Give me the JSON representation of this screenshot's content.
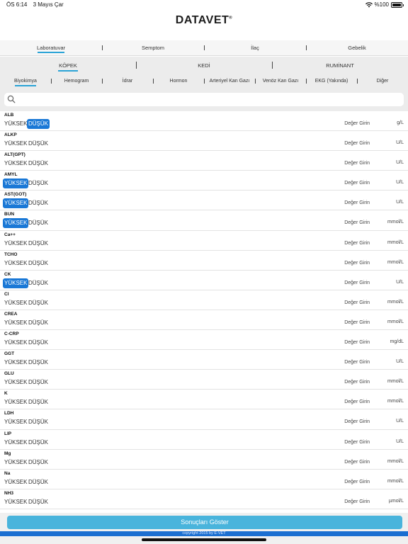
{
  "status_bar": {
    "time": "ÖS 6:14",
    "date": "3 Mayıs Çar",
    "battery": "%100",
    "battery_level": 1.0
  },
  "header": {
    "logo": "DATAVET",
    "logo_mark": "®",
    "close_icon": "close-icon"
  },
  "main_tabs": [
    {
      "label": "Laboratuvar",
      "active": true
    },
    {
      "label": "Semptom",
      "active": false
    },
    {
      "label": "İlaç",
      "active": false
    },
    {
      "label": "Gebelik",
      "active": false
    }
  ],
  "species_tabs": [
    {
      "label": "KÖPEK",
      "active": true
    },
    {
      "label": "KEDİ",
      "active": false
    },
    {
      "label": "RUMİNANT",
      "active": false
    }
  ],
  "category_tabs": [
    {
      "label": "Biyokimya",
      "active": true
    },
    {
      "label": "Hemogram",
      "active": false
    },
    {
      "label": "İdrar",
      "active": false
    },
    {
      "label": "Hormon",
      "active": false
    },
    {
      "label": "Arteriyel Kan Gazı",
      "active": false
    },
    {
      "label": "Venöz Kan Gazı",
      "active": false
    },
    {
      "label": "EKG (Yakında)",
      "active": false
    },
    {
      "label": "Diğer",
      "active": false
    }
  ],
  "search": {
    "placeholder": "",
    "icon": "search-icon"
  },
  "labels": {
    "high": "YÜKSEK",
    "low": "DÜŞÜK",
    "enter": "Değer Girin"
  },
  "tests": [
    {
      "name": "ALB",
      "unit": "g/L",
      "selected": "low"
    },
    {
      "name": "ALKP",
      "unit": "U/L",
      "selected": ""
    },
    {
      "name": "ALT(GPT)",
      "unit": "U/L",
      "selected": ""
    },
    {
      "name": "AMYL",
      "unit": "U/L",
      "selected": "high"
    },
    {
      "name": "AST(GOT)",
      "unit": "U/L",
      "selected": "high"
    },
    {
      "name": "BUN",
      "unit": "mmol/L",
      "selected": "high"
    },
    {
      "name": "Ca++",
      "unit": "mmol/L",
      "selected": ""
    },
    {
      "name": "TCHO",
      "unit": "mmol/L",
      "selected": ""
    },
    {
      "name": "CK",
      "unit": "U/L",
      "selected": "high"
    },
    {
      "name": "Cl",
      "unit": "mmol/L",
      "selected": ""
    },
    {
      "name": "CREA",
      "unit": "mmol/L",
      "selected": ""
    },
    {
      "name": "C-CRP",
      "unit": "mg/dL",
      "selected": ""
    },
    {
      "name": "GGT",
      "unit": "U/L",
      "selected": ""
    },
    {
      "name": "GLU",
      "unit": "mmol/L",
      "selected": ""
    },
    {
      "name": "K",
      "unit": "mmol/L",
      "selected": ""
    },
    {
      "name": "LDH",
      "unit": "U/L",
      "selected": ""
    },
    {
      "name": "LIP",
      "unit": "U/L",
      "selected": ""
    },
    {
      "name": "Mg",
      "unit": "mmol/L",
      "selected": ""
    },
    {
      "name": "Na",
      "unit": "mmol/L",
      "selected": ""
    },
    {
      "name": "NH3",
      "unit": "µmol/L",
      "selected": ""
    }
  ],
  "footer": {
    "show_button": "Sonuçları Göster",
    "copyright": "copyright 2015 by E-VET"
  },
  "colors": {
    "accent": "#2aa3d6",
    "selected": "#1a78d6",
    "button": "#49b4dc",
    "copyright_bar": "#1b6fd1"
  }
}
